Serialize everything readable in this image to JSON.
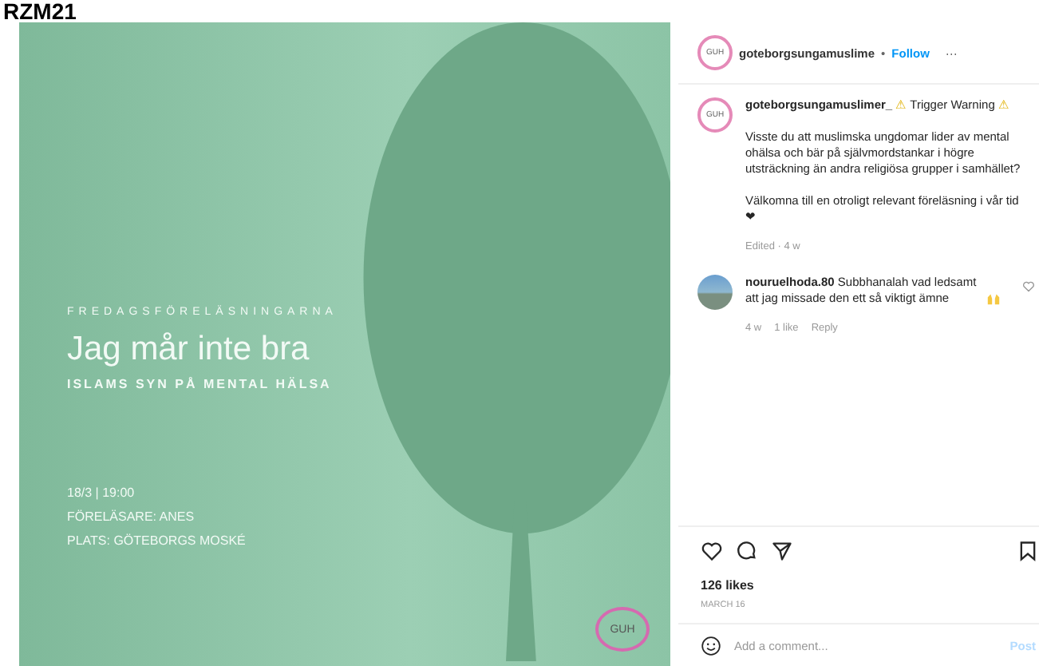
{
  "header_text": "RZM21",
  "post_image": {
    "kicker": "FREDAGSFÖRELÄSNINGARNA",
    "title": "Jag mår inte bra",
    "subtitle": "ISLAMS SYN PÅ MENTAL HÄLSA",
    "details": [
      "18/3 | 19:00",
      "FÖRELÄSARE: ANES",
      "PLATS: GÖTEBORGS MOSKÉ"
    ],
    "logo_text": "GUH"
  },
  "post_header": {
    "avatar_text": "GUH",
    "username": "goteborgsungamuslime",
    "separator": "•",
    "follow": "Follow",
    "more": "···"
  },
  "caption": {
    "avatar_text": "GUH",
    "username": "goteborgsungamuslimer_",
    "warning": "⚠",
    "text": "Trigger Warning",
    "paragraphs": [
      "Visste du att muslimska ungdomar lider av mental ohälsa och bär på självmordstankar i högre utsträckning än andra religiösa grupper i samhället?",
      "Välkomna till en otroligt relevant föreläsning i vår tid ❤"
    ],
    "meta": "Edited · 4 w"
  },
  "comments": [
    {
      "username": "nouruelhoda.80",
      "text": "Subbhanalah vad ledsamt att jag missade den ett så viktigt ämne",
      "time": "4 w",
      "likes": "1 like",
      "reply": "Reply"
    }
  ],
  "likes": "126 likes",
  "date": "MARCH 16",
  "comment_field": {
    "placeholder": "Add a comment...",
    "post": "Post"
  }
}
